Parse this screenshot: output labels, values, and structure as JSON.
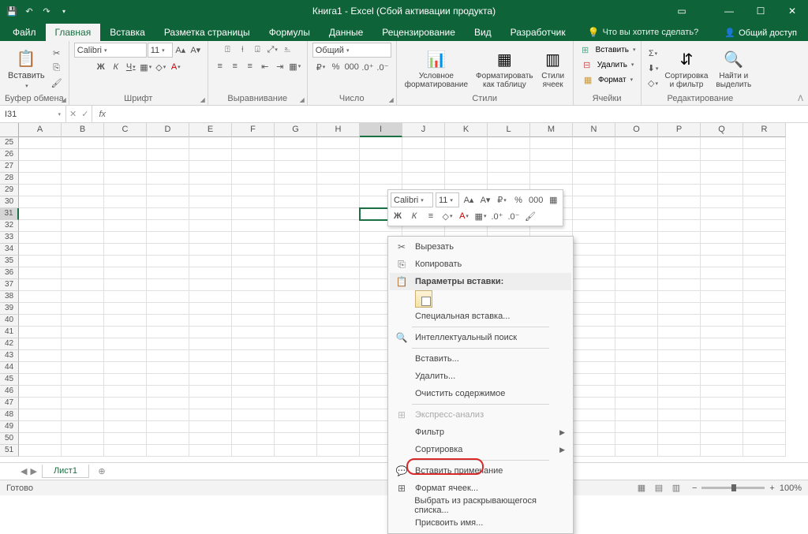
{
  "title": "Книга1 - Excel (Сбой активации продукта)",
  "tabs": {
    "file": "Файл",
    "home": "Главная",
    "insert": "Вставка",
    "layout": "Разметка страницы",
    "formulas": "Формулы",
    "data": "Данные",
    "review": "Рецензирование",
    "view": "Вид",
    "developer": "Разработчик"
  },
  "tellme": "Что вы хотите сделать?",
  "share": "Общий доступ",
  "groups": {
    "clipboard": "Буфер обмена",
    "font": "Шрифт",
    "align": "Выравнивание",
    "number": "Число",
    "styles": "Стили",
    "cells": "Ячейки",
    "editing": "Редактирование"
  },
  "ribbon": {
    "paste": "Вставить",
    "font_name": "Calibri",
    "font_size": "11",
    "number_format": "Общий",
    "cond_format": "Условное\nформатирование",
    "format_table": "Форматировать\nкак таблицу",
    "cell_styles": "Стили\nячеек",
    "insert": "Вставить",
    "delete": "Удалить",
    "format": "Формат",
    "sort_filter": "Сортировка\nи фильтр",
    "find_select": "Найти и\nвыделить"
  },
  "namebox": "I31",
  "sheet": "Лист1",
  "status": "Готово",
  "zoom": "100%",
  "columns": [
    "A",
    "B",
    "C",
    "D",
    "E",
    "F",
    "G",
    "H",
    "I",
    "J",
    "K",
    "L",
    "M",
    "N",
    "O",
    "P",
    "Q",
    "R"
  ],
  "rows": [
    "25",
    "26",
    "27",
    "28",
    "29",
    "30",
    "31",
    "32",
    "33",
    "34",
    "35",
    "36",
    "37",
    "38",
    "39",
    "40",
    "41",
    "42",
    "43",
    "44",
    "45",
    "46",
    "47",
    "48",
    "49",
    "50",
    "51"
  ],
  "mini": {
    "font": "Calibri",
    "size": "11"
  },
  "ctx": {
    "cut": "Вырезать",
    "copy": "Копировать",
    "paste_opts": "Параметры вставки:",
    "paste_special": "Специальная вставка...",
    "smart_lookup": "Интеллектуальный поиск",
    "insert": "Вставить...",
    "delete": "Удалить...",
    "clear": "Очистить содержимое",
    "quick": "Экспресс-анализ",
    "filter": "Фильтр",
    "sort": "Сортировка",
    "comment": "Вставить примечание",
    "format_cells": "Формат ячеек...",
    "dropdown": "Выбрать из раскрывающегося списка...",
    "name": "Присвоить имя..."
  }
}
